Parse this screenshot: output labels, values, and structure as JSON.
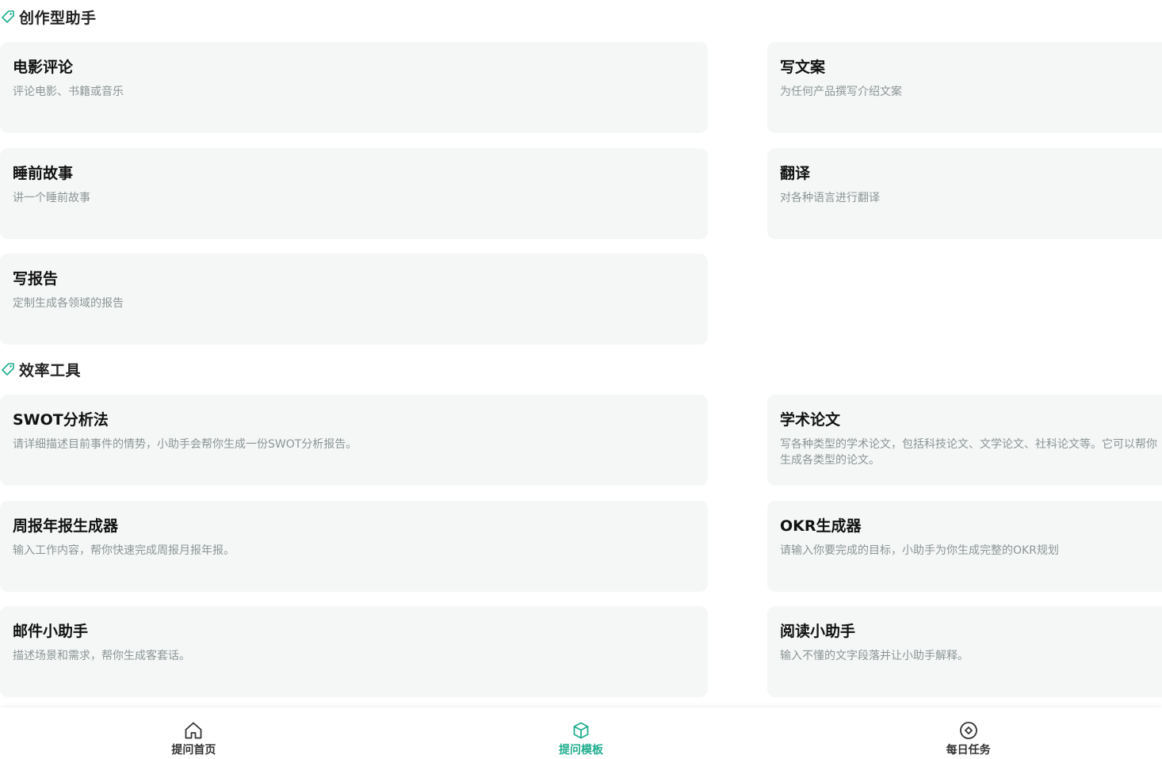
{
  "colors": {
    "accent": "#1fae8e",
    "card_bg": "#f5f7f7",
    "desc_text": "#8c9494"
  },
  "sections": [
    {
      "title": "创作型助手",
      "icon": "tag-icon",
      "cards": [
        {
          "title": "电影评论",
          "desc": "评论电影、书籍或音乐"
        },
        {
          "title": "写文案",
          "desc": "为任何产品撰写介绍文案"
        },
        {
          "title": "睡前故事",
          "desc": "讲一个睡前故事"
        },
        {
          "title": "翻译",
          "desc": "对各种语言进行翻译"
        },
        {
          "title": "写报告",
          "desc": "定制生成各领域的报告"
        }
      ]
    },
    {
      "title": "效率工具",
      "icon": "tag-icon",
      "cards": [
        {
          "title": "SWOT分析法",
          "desc": "请详细描述目前事件的情势，小助手会帮你生成一份SWOT分析报告。"
        },
        {
          "title": "学术论文",
          "desc": "写各种类型的学术论文，包括科技论文、文学论文、社科论文等。它可以帮你生成各类型的论文。"
        },
        {
          "title": "周报年报生成器",
          "desc": "输入工作内容，帮你快速完成周报月报年报。"
        },
        {
          "title": "OKR生成器",
          "desc": "请输入你要完成的目标，小助手为你生成完整的OKR规划"
        },
        {
          "title": "邮件小助手",
          "desc": "描述场景和需求，帮你生成客套话。"
        },
        {
          "title": "阅读小助手",
          "desc": "输入不懂的文字段落并让小助手解释。"
        }
      ]
    }
  ],
  "bottom_nav": [
    {
      "label": "提问首页",
      "icon": "home-icon",
      "active": false
    },
    {
      "label": "提问模板",
      "icon": "cube-icon",
      "active": true
    },
    {
      "label": "每日任务",
      "icon": "target-icon",
      "active": false
    }
  ]
}
